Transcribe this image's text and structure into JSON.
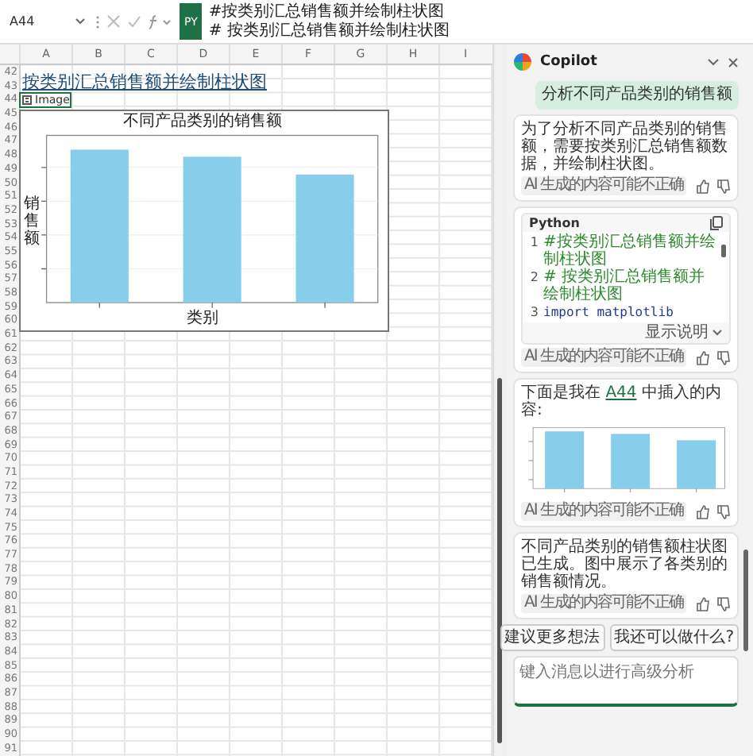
{
  "formula_bar": {
    "name_box": "A44",
    "badge": "PY",
    "lines": [
      "#按类别汇总销售额并绘制柱状图",
      "# 按类别汇总销售额并绘制柱状图"
    ]
  },
  "sheet": {
    "columns": [
      "A",
      "B",
      "C",
      "D",
      "E",
      "F",
      "G",
      "H",
      "I"
    ],
    "rows": [
      "42",
      "43",
      "44",
      "45",
      "46",
      "47",
      "48",
      "49",
      "50",
      "51",
      "52",
      "53",
      "54",
      "55",
      "56",
      "57",
      "58",
      "59",
      "60",
      "61",
      "62",
      "63",
      "64",
      "65",
      "66",
      "67",
      "68",
      "69",
      "70",
      "71",
      "72",
      "73",
      "74",
      "75",
      "76",
      "77",
      "78",
      "79",
      "80",
      "81",
      "82",
      "83",
      "84",
      "85",
      "86",
      "87",
      "88",
      "89",
      "90",
      "91"
    ],
    "heading": "按类别汇总销售额并绘制柱状图",
    "cell_value": "Image",
    "chart_image": {
      "title": "不同产品类别的销售额",
      "xlabel": "类别",
      "ylabel": "销售额"
    }
  },
  "copilot": {
    "title": "Copilot",
    "messages": [
      {
        "kind": "user",
        "text": "分析不同产品类别的销售额"
      },
      {
        "kind": "text",
        "text": "为了分析不同产品类别的销售额，需要按类别汇总销售额数据，并绘制柱状图。",
        "disclaimer": "AI 生成的内容可能不正确"
      },
      {
        "kind": "code",
        "language": "Python",
        "lines": [
          {
            "number": "1",
            "code": "#按类别汇总销售额并绘制柱状图",
            "kind": "comment"
          },
          {
            "number": "2",
            "code": "# 按类别汇总销售额并绘制柱状图",
            "kind": "comment"
          },
          {
            "number": "3",
            "code": "import matplotlib",
            "kind": "code"
          }
        ],
        "toggle": "显示说明",
        "disclaimer": "AI 生成的内容可能不正确"
      },
      {
        "kind": "image",
        "before": "下面是我在 ",
        "link": "A44",
        "after": " 中插入的内容:",
        "disclaimer": "AI 生成的内容可能不正确"
      },
      {
        "kind": "text",
        "text": "不同产品类别的销售额柱状图已生成。图中展示了各类别的销售额情况。",
        "disclaimer": "AI 生成的内容可能不正确"
      }
    ],
    "suggestions": [
      "建议更多想法",
      "我还可以做什么?"
    ],
    "input": {
      "placeholder": "键入消息以进行高级分析"
    }
  }
}
